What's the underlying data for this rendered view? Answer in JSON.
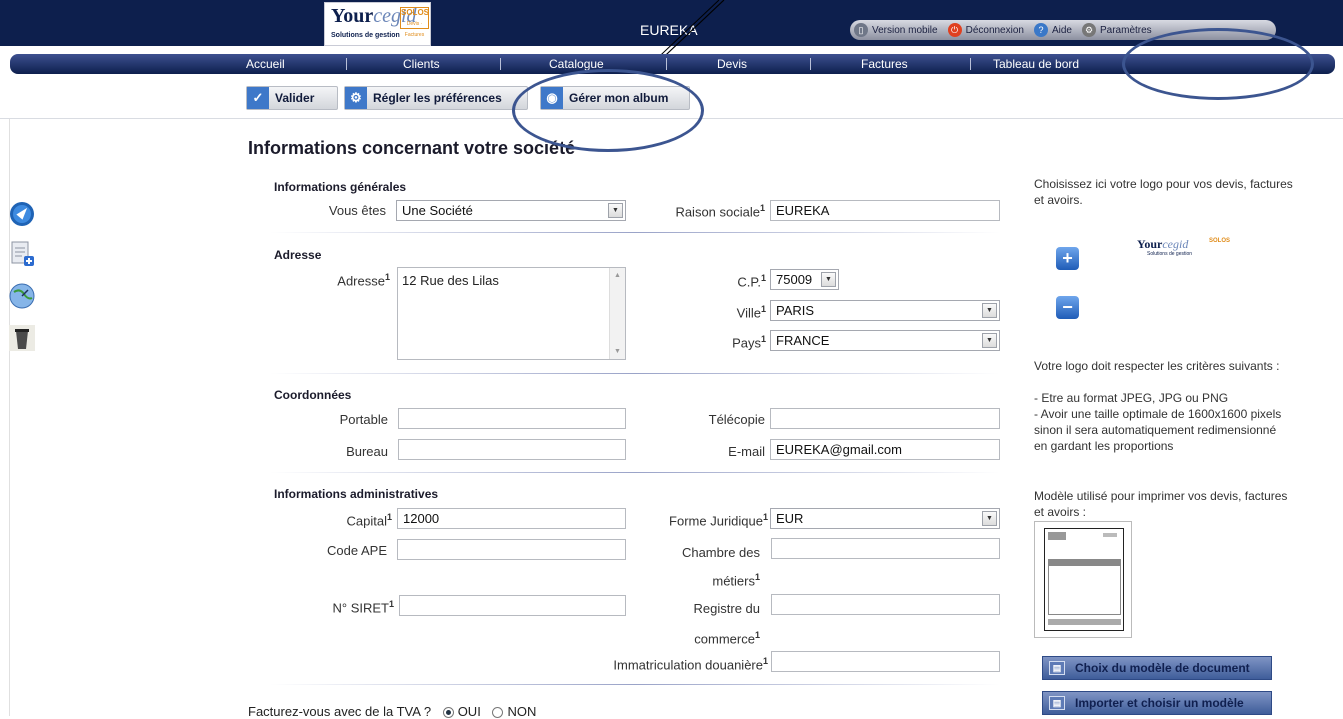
{
  "header": {
    "logo_brand_a": "Your",
    "logo_brand_b": "cegid",
    "logo_tag": "SOLOS",
    "logo_tag_sub": "Devis · Factures",
    "logo_sub": "Solutions de gestion",
    "app_title": "EUREKA",
    "links": {
      "mobile": "Version mobile",
      "logout": "Déconnexion",
      "help": "Aide",
      "settings": "Paramètres"
    }
  },
  "nav": {
    "home": "Accueil",
    "clients": "Clients",
    "catalog": "Catalogue",
    "quotes": "Devis",
    "invoices": "Factures",
    "dashboard": "Tableau de bord"
  },
  "toolbar": {
    "validate": "Valider",
    "prefs": "Régler les préférences",
    "album": "Gérer mon album"
  },
  "page_title": "Informations concernant votre société",
  "general": {
    "title": "Informations générales",
    "vous_etes_label": "Vous êtes",
    "vous_etes_value": "Une Société",
    "raison_label": "Raison sociale",
    "raison_value": "EUREKA"
  },
  "address": {
    "title": "Adresse",
    "adresse_label": "Adresse",
    "adresse_value": "12 Rue des Lilas",
    "cp_label": "C.P.",
    "cp_value": "75009",
    "ville_label": "Ville",
    "ville_value": "PARIS",
    "pays_label": "Pays",
    "pays_value": "FRANCE"
  },
  "contact": {
    "title": "Coordonnées",
    "portable_label": "Portable",
    "portable_value": "",
    "telecopie_label": "Télécopie",
    "telecopie_value": "",
    "bureau_label": "Bureau",
    "bureau_value": "",
    "email_label": "E-mail",
    "email_value": "EUREKA@gmail.com"
  },
  "admin": {
    "title": "Informations administratives",
    "capital_label": "Capital",
    "capital_value": "12000",
    "forme_label": "Forme Juridique",
    "forme_value": "EUR",
    "ape_label": "Code APE",
    "ape_value": "",
    "chambre_label_1": "Chambre des",
    "chambre_label_2": "métiers",
    "chambre_value": "",
    "siret_label": "N° SIRET",
    "siret_value": "",
    "registre_label_1": "Registre du",
    "registre_label_2": "commerce",
    "registre_value": "",
    "immat_label": "Immatriculation douanière",
    "immat_value": ""
  },
  "required_mark": "1",
  "tva": {
    "question": "Facturez-vous avec de la TVA ?",
    "yes": "OUI",
    "no": "NON",
    "selected": "OUI"
  },
  "sidebar_right": {
    "logo_intro": "Choisissez ici votre logo pour vos devis, factures et avoirs.",
    "add": "+",
    "remove": "−",
    "criteria_title": "Votre logo doit respecter les critères suivants :",
    "criteria_1": "- Etre au format JPEG, JPG ou PNG",
    "criteria_2": "- Avoir une taille optimale de 1600x1600 pixels sinon il sera automatiquement redimensionné en gardant les proportions",
    "model_text": "Modèle utilisé pour imprimer vos devis, factures et avoirs :",
    "btn_choose_model": "Choix du modèle de document",
    "btn_import_model": "Importer et choisir un modèle"
  },
  "colors": {
    "header_bg": "#0d1f4d",
    "nav_bg": "#1c2d63",
    "accent": "#3f5d9a",
    "annotation": "#3c5590"
  }
}
